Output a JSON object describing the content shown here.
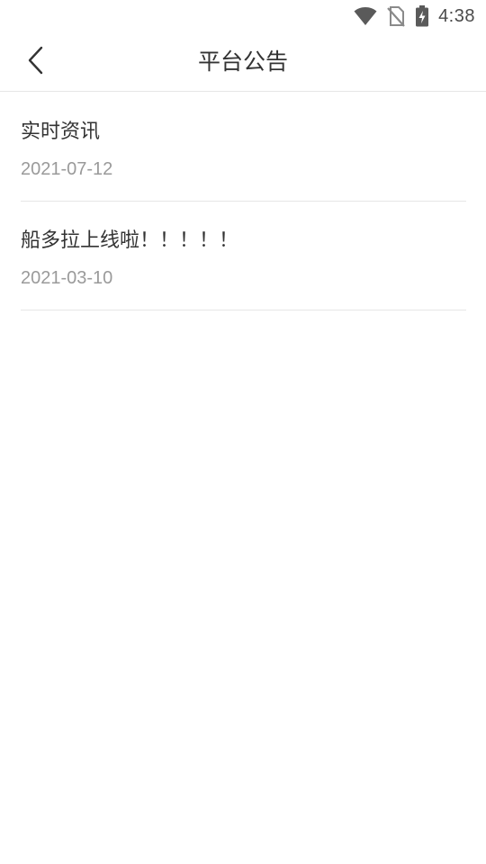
{
  "status_bar": {
    "time": "4:38",
    "icons": [
      "wifi-icon",
      "no-sim-icon",
      "battery-charging-icon"
    ]
  },
  "header": {
    "back_icon": "chevron-left-icon",
    "title": "平台公告"
  },
  "notices": [
    {
      "title": "实时资讯",
      "date": "2021-07-12"
    },
    {
      "title": "船多拉上线啦！！！！！",
      "date": "2021-03-10"
    }
  ],
  "colors": {
    "title_text": "#333333",
    "date_text": "#9a9a9a",
    "divider": "#e6e6e6",
    "status_icons": "#5a5a5a"
  }
}
